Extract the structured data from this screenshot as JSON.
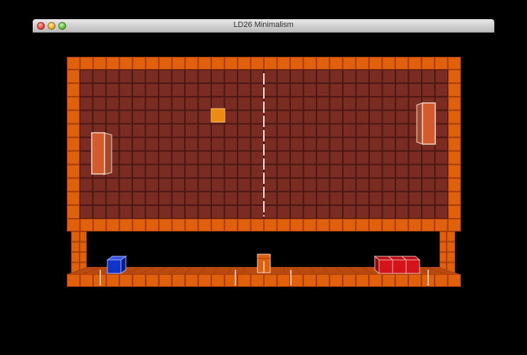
{
  "window": {
    "title": "LD26 Minimalism"
  },
  "colors": {
    "frame_brick": "#e0600c",
    "frame_brick_edge": "#a93e06",
    "wall_tile": "#7a2b22",
    "wall_grid": "#4a1812",
    "inner_side": "#8a3a22",
    "paddle_fill": "#d45b2c",
    "paddle_edge": "#f1d5c8",
    "ball": "#ef8a10",
    "player_block": "#1233c8",
    "enemy_block": "#d4141a",
    "center_line": "#f2e6dc"
  }
}
